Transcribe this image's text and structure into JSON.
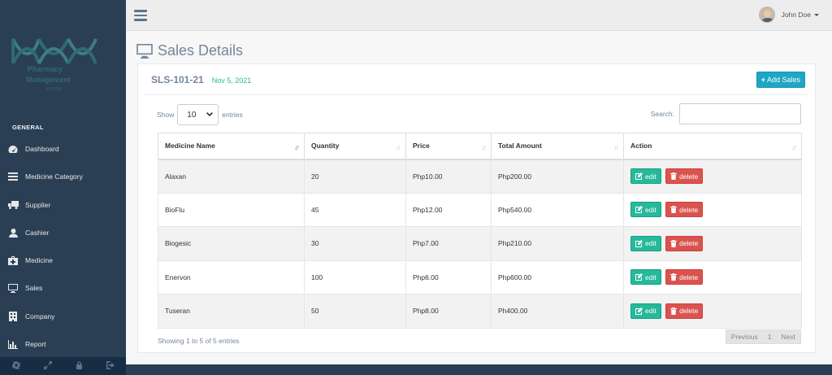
{
  "brand": {
    "line1": "Pharmacy",
    "line2": "Management",
    "line3": "SYSTEM"
  },
  "sidebar": {
    "section_title": "GENERAL",
    "items": [
      {
        "label": "Dashboard",
        "icon": "tachometer-icon"
      },
      {
        "label": "Medicine Category",
        "icon": "list-icon"
      },
      {
        "label": "Supplier",
        "icon": "truck-icon"
      },
      {
        "label": "Cashier",
        "icon": "user-icon"
      },
      {
        "label": "Medicine",
        "icon": "medkit-icon"
      },
      {
        "label": "Sales",
        "icon": "desktop-icon"
      },
      {
        "label": "Company",
        "icon": "building-icon"
      },
      {
        "label": "Report",
        "icon": "bar-chart-icon"
      }
    ],
    "footer_icons": [
      "gear-icon",
      "fullscreen-icon",
      "lock-icon",
      "logout-icon"
    ]
  },
  "topnav": {
    "user_name": "John Doe"
  },
  "page": {
    "title": "Sales Details"
  },
  "sale": {
    "id": "SLS-101-21",
    "date": "Nov 5, 2021",
    "add_button": "Add Sales"
  },
  "table_controls": {
    "show_label": "Show",
    "entries_value": "10",
    "entries_label": "entries",
    "search_label": "Search:",
    "search_value": ""
  },
  "table": {
    "columns": [
      "Medicine Name",
      "Quantity",
      "Price",
      "Total Amount",
      "Action"
    ],
    "rows": [
      {
        "name": "Alaxan",
        "quantity": "20",
        "price": "Php10.00",
        "total": "Php200.00"
      },
      {
        "name": "BioFlu",
        "quantity": "45",
        "price": "Php12.00",
        "total": "Php540.00"
      },
      {
        "name": "Biogesic",
        "quantity": "30",
        "price": "Php7.00",
        "total": "Php210.00"
      },
      {
        "name": "Enervon",
        "quantity": "100",
        "price": "Php6.00",
        "total": "Php600.00"
      },
      {
        "name": "Tuseran",
        "quantity": "50",
        "price": "Php8.00",
        "total": "Ph400.00"
      }
    ],
    "edit_label": "edit",
    "delete_label": "delete"
  },
  "footer": {
    "info": "Showing 1 to 5 of 5 entries",
    "previous": "Previous",
    "page": "1",
    "next": "Next"
  },
  "colors": {
    "sidebar": "#2A3F54",
    "accent_green": "#26B99A",
    "accent_red": "#D9534F",
    "accent_blue": "#1FA6C5"
  }
}
